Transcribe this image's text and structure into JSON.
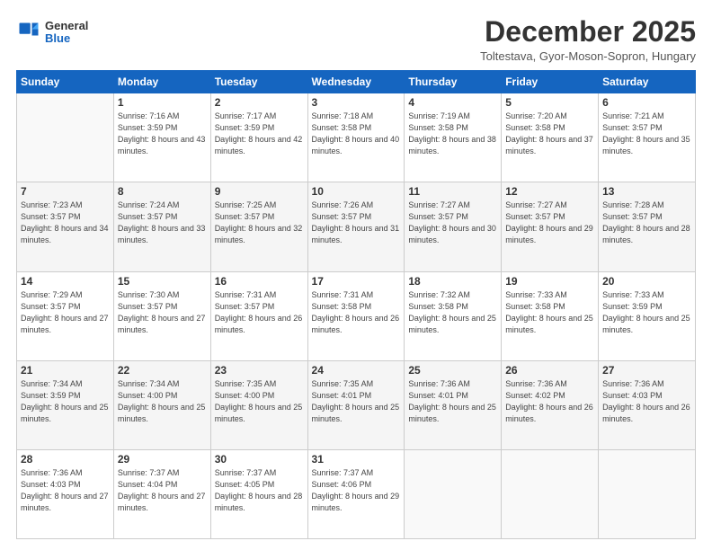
{
  "header": {
    "logo": {
      "line1": "General",
      "line2": "Blue"
    },
    "title": "December 2025",
    "subtitle": "Toltestava, Gyor-Moson-Sopron, Hungary"
  },
  "columns": [
    "Sunday",
    "Monday",
    "Tuesday",
    "Wednesday",
    "Thursday",
    "Friday",
    "Saturday"
  ],
  "weeks": [
    [
      {
        "day": "",
        "empty": true
      },
      {
        "day": "1",
        "sunrise": "Sunrise: 7:16 AM",
        "sunset": "Sunset: 3:59 PM",
        "daylight": "Daylight: 8 hours and 43 minutes."
      },
      {
        "day": "2",
        "sunrise": "Sunrise: 7:17 AM",
        "sunset": "Sunset: 3:59 PM",
        "daylight": "Daylight: 8 hours and 42 minutes."
      },
      {
        "day": "3",
        "sunrise": "Sunrise: 7:18 AM",
        "sunset": "Sunset: 3:58 PM",
        "daylight": "Daylight: 8 hours and 40 minutes."
      },
      {
        "day": "4",
        "sunrise": "Sunrise: 7:19 AM",
        "sunset": "Sunset: 3:58 PM",
        "daylight": "Daylight: 8 hours and 38 minutes."
      },
      {
        "day": "5",
        "sunrise": "Sunrise: 7:20 AM",
        "sunset": "Sunset: 3:58 PM",
        "daylight": "Daylight: 8 hours and 37 minutes."
      },
      {
        "day": "6",
        "sunrise": "Sunrise: 7:21 AM",
        "sunset": "Sunset: 3:57 PM",
        "daylight": "Daylight: 8 hours and 35 minutes."
      }
    ],
    [
      {
        "day": "7",
        "sunrise": "Sunrise: 7:23 AM",
        "sunset": "Sunset: 3:57 PM",
        "daylight": "Daylight: 8 hours and 34 minutes."
      },
      {
        "day": "8",
        "sunrise": "Sunrise: 7:24 AM",
        "sunset": "Sunset: 3:57 PM",
        "daylight": "Daylight: 8 hours and 33 minutes."
      },
      {
        "day": "9",
        "sunrise": "Sunrise: 7:25 AM",
        "sunset": "Sunset: 3:57 PM",
        "daylight": "Daylight: 8 hours and 32 minutes."
      },
      {
        "day": "10",
        "sunrise": "Sunrise: 7:26 AM",
        "sunset": "Sunset: 3:57 PM",
        "daylight": "Daylight: 8 hours and 31 minutes."
      },
      {
        "day": "11",
        "sunrise": "Sunrise: 7:27 AM",
        "sunset": "Sunset: 3:57 PM",
        "daylight": "Daylight: 8 hours and 30 minutes."
      },
      {
        "day": "12",
        "sunrise": "Sunrise: 7:27 AM",
        "sunset": "Sunset: 3:57 PM",
        "daylight": "Daylight: 8 hours and 29 minutes."
      },
      {
        "day": "13",
        "sunrise": "Sunrise: 7:28 AM",
        "sunset": "Sunset: 3:57 PM",
        "daylight": "Daylight: 8 hours and 28 minutes."
      }
    ],
    [
      {
        "day": "14",
        "sunrise": "Sunrise: 7:29 AM",
        "sunset": "Sunset: 3:57 PM",
        "daylight": "Daylight: 8 hours and 27 minutes."
      },
      {
        "day": "15",
        "sunrise": "Sunrise: 7:30 AM",
        "sunset": "Sunset: 3:57 PM",
        "daylight": "Daylight: 8 hours and 27 minutes."
      },
      {
        "day": "16",
        "sunrise": "Sunrise: 7:31 AM",
        "sunset": "Sunset: 3:57 PM",
        "daylight": "Daylight: 8 hours and 26 minutes."
      },
      {
        "day": "17",
        "sunrise": "Sunrise: 7:31 AM",
        "sunset": "Sunset: 3:58 PM",
        "daylight": "Daylight: 8 hours and 26 minutes."
      },
      {
        "day": "18",
        "sunrise": "Sunrise: 7:32 AM",
        "sunset": "Sunset: 3:58 PM",
        "daylight": "Daylight: 8 hours and 25 minutes."
      },
      {
        "day": "19",
        "sunrise": "Sunrise: 7:33 AM",
        "sunset": "Sunset: 3:58 PM",
        "daylight": "Daylight: 8 hours and 25 minutes."
      },
      {
        "day": "20",
        "sunrise": "Sunrise: 7:33 AM",
        "sunset": "Sunset: 3:59 PM",
        "daylight": "Daylight: 8 hours and 25 minutes."
      }
    ],
    [
      {
        "day": "21",
        "sunrise": "Sunrise: 7:34 AM",
        "sunset": "Sunset: 3:59 PM",
        "daylight": "Daylight: 8 hours and 25 minutes."
      },
      {
        "day": "22",
        "sunrise": "Sunrise: 7:34 AM",
        "sunset": "Sunset: 4:00 PM",
        "daylight": "Daylight: 8 hours and 25 minutes."
      },
      {
        "day": "23",
        "sunrise": "Sunrise: 7:35 AM",
        "sunset": "Sunset: 4:00 PM",
        "daylight": "Daylight: 8 hours and 25 minutes."
      },
      {
        "day": "24",
        "sunrise": "Sunrise: 7:35 AM",
        "sunset": "Sunset: 4:01 PM",
        "daylight": "Daylight: 8 hours and 25 minutes."
      },
      {
        "day": "25",
        "sunrise": "Sunrise: 7:36 AM",
        "sunset": "Sunset: 4:01 PM",
        "daylight": "Daylight: 8 hours and 25 minutes."
      },
      {
        "day": "26",
        "sunrise": "Sunrise: 7:36 AM",
        "sunset": "Sunset: 4:02 PM",
        "daylight": "Daylight: 8 hours and 26 minutes."
      },
      {
        "day": "27",
        "sunrise": "Sunrise: 7:36 AM",
        "sunset": "Sunset: 4:03 PM",
        "daylight": "Daylight: 8 hours and 26 minutes."
      }
    ],
    [
      {
        "day": "28",
        "sunrise": "Sunrise: 7:36 AM",
        "sunset": "Sunset: 4:03 PM",
        "daylight": "Daylight: 8 hours and 27 minutes."
      },
      {
        "day": "29",
        "sunrise": "Sunrise: 7:37 AM",
        "sunset": "Sunset: 4:04 PM",
        "daylight": "Daylight: 8 hours and 27 minutes."
      },
      {
        "day": "30",
        "sunrise": "Sunrise: 7:37 AM",
        "sunset": "Sunset: 4:05 PM",
        "daylight": "Daylight: 8 hours and 28 minutes."
      },
      {
        "day": "31",
        "sunrise": "Sunrise: 7:37 AM",
        "sunset": "Sunset: 4:06 PM",
        "daylight": "Daylight: 8 hours and 29 minutes."
      },
      {
        "day": "",
        "empty": true
      },
      {
        "day": "",
        "empty": true
      },
      {
        "day": "",
        "empty": true
      }
    ]
  ]
}
